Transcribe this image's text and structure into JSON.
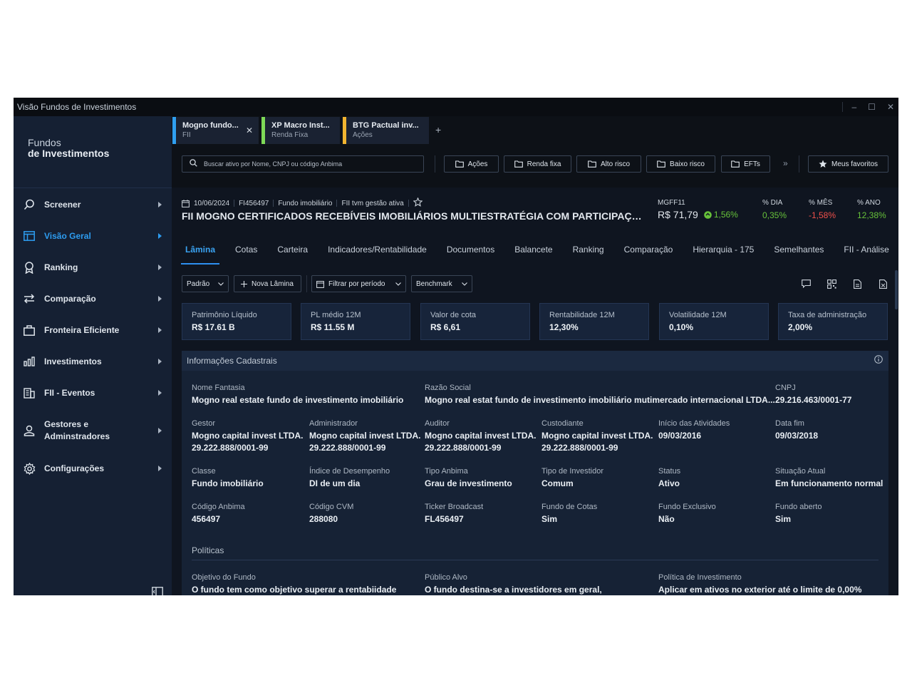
{
  "window": {
    "title": "Visão Fundos de Investimentos",
    "minimize": "–",
    "maximize": "☐",
    "close": "✕"
  },
  "brand": {
    "line1": "Fundos",
    "line2": "de Investimentos"
  },
  "nav": [
    {
      "label": "Screener",
      "icon": "search-icon",
      "active": false
    },
    {
      "label": "Visão Geral",
      "icon": "layout-icon",
      "active": true
    },
    {
      "label": "Ranking",
      "icon": "ribbon-icon",
      "active": false
    },
    {
      "label": "Comparação",
      "icon": "compare-arrows-icon",
      "active": false
    },
    {
      "label": "Fronteira Eficiente",
      "icon": "briefcase-icon",
      "active": false
    },
    {
      "label": "Investimentos",
      "icon": "bar-chart-icon",
      "active": false
    },
    {
      "label": "FII - Eventos",
      "icon": "building-icon",
      "active": false
    },
    {
      "label": "Gestores e Adminstradores",
      "icon": "user-icon",
      "active": false
    },
    {
      "label": "Configurações",
      "icon": "gear-icon",
      "active": false
    }
  ],
  "tabs": [
    {
      "title": "Mogno fundo...",
      "subtitle": "FII",
      "color": "#2f9ff0",
      "closable": true,
      "close": "✕"
    },
    {
      "title": "XP Macro Inst...",
      "subtitle": "Renda Fixa",
      "color": "#7ed957",
      "closable": false
    },
    {
      "title": "BTG Pactual inv...",
      "subtitle": "Ações",
      "color": "#f2b530",
      "closable": false
    }
  ],
  "add_tab": "+",
  "search": {
    "placeholder": "Buscar ativo por Nome, CNPJ ou código Anbima"
  },
  "quick_filters": [
    "Ações",
    "Renda fixa",
    "Alto risco",
    "Baixo risco",
    "EFTs"
  ],
  "more": "»",
  "favorites": "Meus favoritos",
  "fund": {
    "date": "10/06/2024",
    "code": "FI456497",
    "type": "Fundo imobiliário",
    "manager": "FII tvm gestão ativa",
    "title": "FII MOGNO CERTIFICADOS RECEBÍVEIS IMOBILIÁRIOS MULTIESTRATÉGIA COM PARTICIPAÇÃO...",
    "ticker": "MGFF11",
    "price": "R$ 71,79",
    "change": "1,56%",
    "stats": [
      {
        "label": "% DIA",
        "value": "0,35%",
        "color": "#67c23a"
      },
      {
        "label": "% MÊS",
        "value": "-1,58%",
        "color": "#f0504a"
      },
      {
        "label": "% ANO",
        "value": "12,38%",
        "color": "#67c23a"
      }
    ]
  },
  "sub_tabs": [
    "Lâmina",
    "Cotas",
    "Carteira",
    "Indicadores/Rentabilidade",
    "Documentos",
    "Balancete",
    "Ranking",
    "Comparação",
    "Hierarquia - 175",
    "Semelhantes",
    "FII - Análise"
  ],
  "filters": {
    "padrao": "Padrão",
    "nova_lamina": "Nova Lâmina",
    "periodo": "Filtrar por período",
    "benchmark": "Benchmark"
  },
  "cards": [
    {
      "label": "Patrimônio Líquido",
      "value": "R$ 17.61 B"
    },
    {
      "label": "PL médio 12M",
      "value": "R$ 11.55 M"
    },
    {
      "label": "Valor de cota",
      "value": "R$ 6,61"
    },
    {
      "label": "Rentabilidade 12M",
      "value": "12,30%"
    },
    {
      "label": "Volatilidade 12M",
      "value": "0,10%"
    },
    {
      "label": "Taxa de administração",
      "value": "2,00%"
    }
  ],
  "info": {
    "title": "Informações Cadastrais",
    "nome_fantasia": {
      "label": "Nome Fantasia",
      "value": "Mogno real estate fundo de investimento imobiliário"
    },
    "razao_social": {
      "label": "Razão Social",
      "value": "Mogno real estat fundo de investimento imobiliário mutimercado internacional LTDA..."
    },
    "cnpj": {
      "label": "CNPJ",
      "value": "29.216.463/0001-77"
    },
    "gestor": {
      "label": "Gestor",
      "line1": "Mogno capital invest LTDA.",
      "line2": "29.222.888/0001-99"
    },
    "administrador": {
      "label": "Administrador",
      "line1": "Mogno capital invest LTDA.",
      "line2": "29.222.888/0001-99"
    },
    "auditor": {
      "label": "Auditor",
      "line1": "Mogno capital invest LTDA.",
      "line2": "29.222.888/0001-99"
    },
    "custodiante": {
      "label": "Custodiante",
      "line1": "Mogno capital invest LTDA.",
      "line2": "29.222.888/0001-99"
    },
    "inicio": {
      "label": "Início das Atividades",
      "value": "09/03/2016"
    },
    "data_fim": {
      "label": "Data fim",
      "value": "09/03/2018"
    },
    "classe": {
      "label": "Classe",
      "value": "Fundo imobiliário"
    },
    "indice": {
      "label": "Índice de Desempenho",
      "value": "DI de um dia"
    },
    "tipo_anbima": {
      "label": "Tipo Anbima",
      "value": "Grau de investimento"
    },
    "tipo_investidor": {
      "label": "Tipo de Investidor",
      "value": "Comum"
    },
    "status": {
      "label": "Status",
      "value": "Ativo"
    },
    "situacao": {
      "label": "Situação Atual",
      "value": "Em funcionamento normal"
    },
    "codigo_anbima": {
      "label": "Código Anbima",
      "value": "456497"
    },
    "codigo_cvm": {
      "label": "Código CVM",
      "value": "288080"
    },
    "ticker_broadcast": {
      "label": "Ticker Broadcast",
      "value": "FL456497"
    },
    "fundo_cotas": {
      "label": "Fundo de Cotas",
      "value": "Sim"
    },
    "fundo_exclusivo": {
      "label": "Fundo Exclusivo",
      "value": "Não"
    },
    "fundo_aberto": {
      "label": "Fundo aberto",
      "value": "Sim"
    },
    "politicas": "Políticas",
    "objetivo": {
      "label": "Objetivo do Fundo",
      "value": "O fundo tem como objetivo superar a rentabiidade"
    },
    "publico": {
      "label": "Público Alvo",
      "value": "O fundo destina-se a investidores em geral,"
    },
    "politica_inv": {
      "label": "Política de Investimento",
      "value": "Aplicar em ativos no exterior até o limite de 0,00%"
    }
  }
}
